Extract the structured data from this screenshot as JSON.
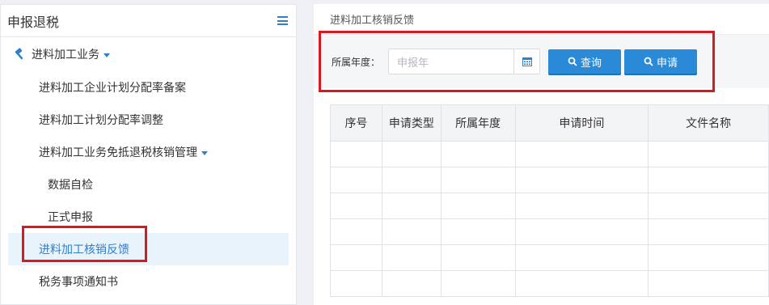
{
  "sidebar": {
    "title": "申报退税",
    "group_label": "进料加工业务",
    "items": [
      {
        "label": "进料加工企业计划分配率备案"
      },
      {
        "label": "进料加工计划分配率调整"
      },
      {
        "label": "进料加工业务免抵退税核销管理"
      },
      {
        "label": "数据自检"
      },
      {
        "label": "正式申报"
      },
      {
        "label": "进料加工核销反馈"
      },
      {
        "label": "税务事项通知书"
      }
    ]
  },
  "main": {
    "breadcrumb": "进料加工核销反馈",
    "search": {
      "label": "所属年度：",
      "placeholder": "申报年",
      "query_button": "查询",
      "apply_button": "申请"
    },
    "table": {
      "columns": [
        "序号",
        "申请类型",
        "所属年度",
        "申请时间",
        "文件名称"
      ]
    }
  },
  "colors": {
    "accent": "#2b8ad8",
    "highlight": "#d9181f",
    "active_bg": "#e9f3fc"
  }
}
